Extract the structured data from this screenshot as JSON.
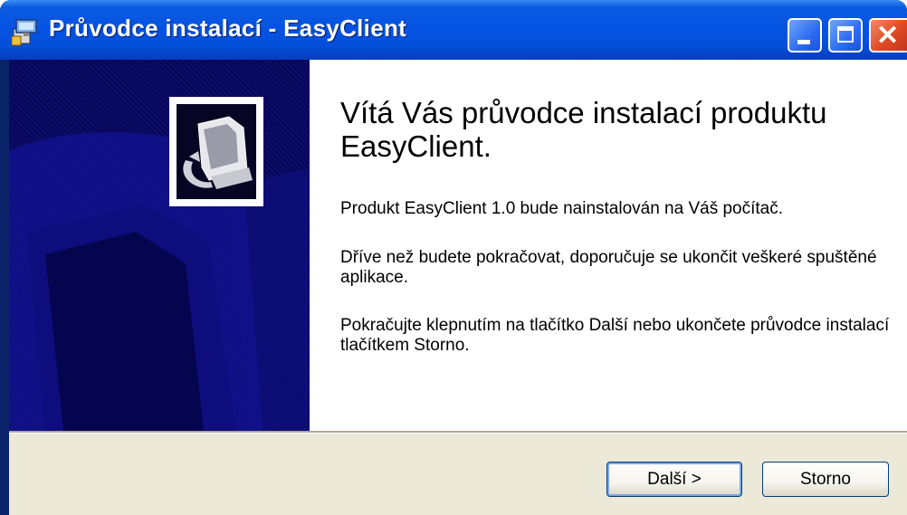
{
  "window": {
    "title": "Průvodce instalací - EasyClient",
    "icons": {
      "app": "installer-icon",
      "minimize": "minimize-icon",
      "maximize": "maximize-icon",
      "close": "close-icon"
    },
    "close_glyph": "✕"
  },
  "sidebar": {
    "logo_icon": "computer-install-icon"
  },
  "content": {
    "welcome_title": "Vítá Vás průvodce instalací produktu EasyClient.",
    "paragraphs": [
      "Produkt EasyClient 1.0 bude nainstalován na Váš počítač.",
      "Dříve než budete pokračovat, doporučuje se ukončit veškeré spuštěné aplikace.",
      "Pokračujte klepnutím na tlačítko Další nebo ukončete průvodce instalací tlačítkem Storno."
    ]
  },
  "buttons": {
    "next": "Další >",
    "cancel": "Storno"
  },
  "colors": {
    "titlebar": "#0553e3",
    "sidebar": "#06065e",
    "dialog_bg": "#ece9d8",
    "close_button": "#de4a24"
  }
}
